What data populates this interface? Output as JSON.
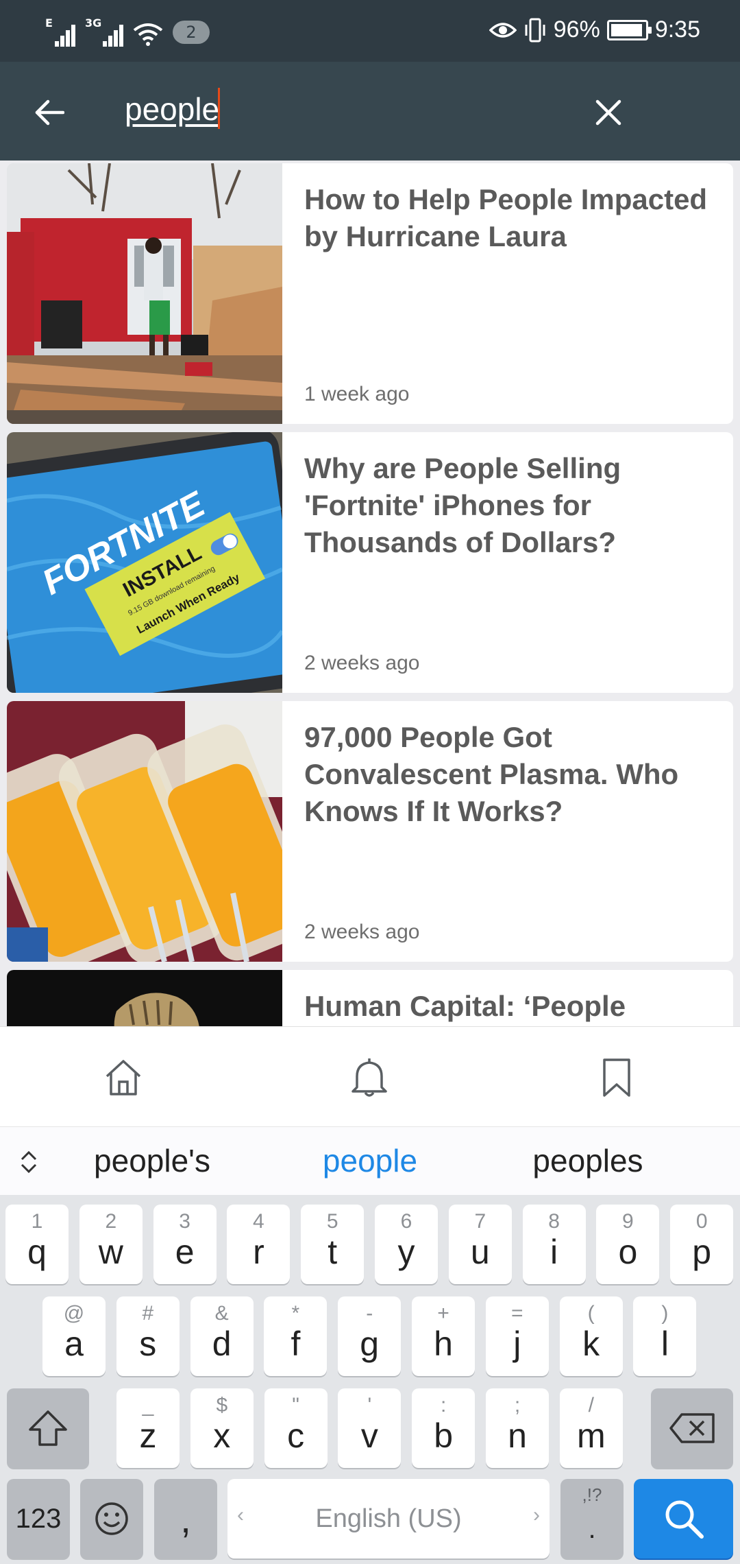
{
  "status_bar": {
    "signal1_tag": "E",
    "signal2_tag": "3G",
    "notification_count": "2",
    "battery_percent": "96%",
    "time": "9:35"
  },
  "search": {
    "query": "people"
  },
  "results": [
    {
      "title": "How to Help People Impacted by Hurricane Laura",
      "time": "1 week ago"
    },
    {
      "title": "Why are People Selling 'Fortnite' iPhones for Thousands of Dollars?",
      "time": "2 weeks ago"
    },
    {
      "title": "97,000 People Got Convalescent Plasma. Who Knows If It Works?",
      "time": "2 weeks ago"
    },
    {
      "title": "Human Capital: ‘People",
      "time": ""
    }
  ],
  "fortnite_image": {
    "brand": "FORTNITE",
    "button": "INSTALL",
    "small": "9.15 GB download remaining",
    "launch": "Launch When Ready"
  },
  "bottom_nav": {
    "items": [
      "home-icon",
      "bell-icon",
      "bookmark-icon"
    ]
  },
  "suggestions": [
    "people's",
    "people",
    "peoples"
  ],
  "keyboard": {
    "row1": [
      [
        "q",
        "1"
      ],
      [
        "w",
        "2"
      ],
      [
        "e",
        "3"
      ],
      [
        "r",
        "4"
      ],
      [
        "t",
        "5"
      ],
      [
        "y",
        "6"
      ],
      [
        "u",
        "7"
      ],
      [
        "i",
        "8"
      ],
      [
        "o",
        "9"
      ],
      [
        "p",
        "0"
      ]
    ],
    "row2": [
      [
        "a",
        "@"
      ],
      [
        "s",
        "#"
      ],
      [
        "d",
        "&"
      ],
      [
        "f",
        "*"
      ],
      [
        "g",
        "-"
      ],
      [
        "h",
        "+"
      ],
      [
        "j",
        "="
      ],
      [
        "k",
        "("
      ],
      [
        "l",
        ")"
      ]
    ],
    "row3": [
      [
        "z",
        "_"
      ],
      [
        "x",
        "$"
      ],
      [
        "c",
        "\""
      ],
      [
        "v",
        "'"
      ],
      [
        "b",
        ":"
      ],
      [
        "n",
        ";"
      ],
      [
        "m",
        "/"
      ]
    ],
    "numbers_label": "123",
    "comma": ",",
    "space_label": "English (US)",
    "period": ".",
    "period_sub": ",!?"
  },
  "colors": {
    "status_bg": "#2f3b43",
    "header_bg": "#37474f",
    "accent": "#1e88e5",
    "caret": "#e64a19"
  }
}
